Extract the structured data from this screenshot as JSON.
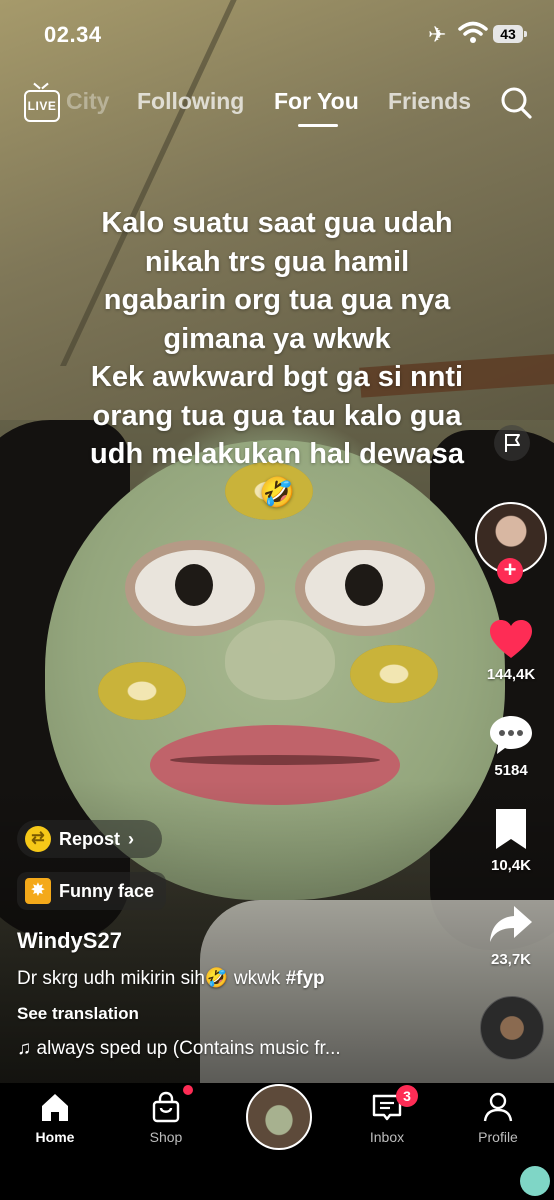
{
  "status_bar": {
    "time": "02.34",
    "battery": "43",
    "airplane_icon": "airplane-icon",
    "wifi_icon": "wifi-icon"
  },
  "top_nav": {
    "live_label": "LIVE",
    "tabs": [
      {
        "label": "City",
        "active": false
      },
      {
        "label": "Following",
        "active": false
      },
      {
        "label": "For You",
        "active": true
      },
      {
        "label": "Friends",
        "active": false
      }
    ],
    "search_icon": "search-icon"
  },
  "video": {
    "caption_lines": [
      "Kalo suatu saat gua udah",
      "nikah trs gua hamil",
      "ngabarin org tua gua nya",
      "gimana ya wkwk",
      "Kek awkward bgt ga si nnti",
      "orang tua gua tau kalo gua",
      "udh melakukan hal dewasa",
      "🤣"
    ]
  },
  "actions": {
    "likes": "144,4K",
    "comments": "5184",
    "bookmarks": "10,4K",
    "shares": "23,7K",
    "like_color": "#fe2c55"
  },
  "post": {
    "repost_label": "Repost",
    "effect_label": "Funny face",
    "username": "WindyS27",
    "description_text": "Dr skrg udh mikirin sih🤣 wkwk ",
    "description_hashtag": "#fyp",
    "see_translation": "See translation",
    "music": "always sped up (Contains music fr..."
  },
  "bottom_nav": {
    "items": [
      {
        "label": "Home",
        "icon": "home-icon"
      },
      {
        "label": "Shop",
        "icon": "shop-bag-icon"
      },
      {
        "label": "Inbox",
        "icon": "inbox-icon",
        "badge": "3"
      },
      {
        "label": "Profile",
        "icon": "profile-icon"
      }
    ]
  },
  "colors": {
    "accent": "#fe2c55",
    "nav_background": "#000000"
  }
}
